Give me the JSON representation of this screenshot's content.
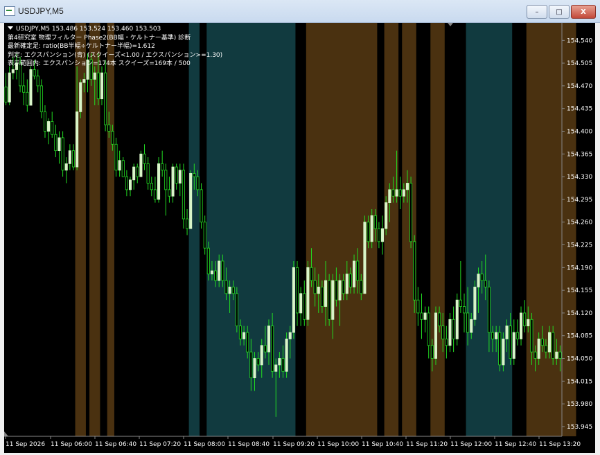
{
  "window": {
    "title": "USDJPY,M5",
    "buttons": {
      "minimize": "–",
      "maximize": "□",
      "close": "X"
    }
  },
  "info_lines": {
    "line1": "USDJPY,M5  153.486 153.524 153.460 153.503",
    "line2": "第4研究室 物理フィルター Phase2(BB幅・ケルトナー基準) 診断",
    "line3": "最新確定足: ratio(BB半幅÷ケルトナー半幅)=1.612",
    "line4": "判定: エクスパンション(青) (スクイーズ<1.00 / エクスパンション>=1.30)",
    "line5": "表示範囲内: エクスパンション=174本  スクイーズ=169本  / 500"
  },
  "colors": {
    "background": "#000000",
    "bull_body": "#d8f5c8",
    "wick": "#22dd22",
    "bear_body": "#000000",
    "squeeze_zone": "#4a3110",
    "expansion_zone": "#113a3f",
    "axis_text": "#ffffff"
  },
  "chart_data": {
    "type": "candlestick",
    "symbol": "USDJPY",
    "timeframe": "M5",
    "ylim": [
      153.93,
      154.567
    ],
    "y_ticks": [
      "154.540",
      "154.505",
      "154.470",
      "154.435",
      "154.400",
      "154.365",
      "154.330",
      "154.295",
      "154.260",
      "154.225",
      "154.190",
      "154.155",
      "154.120",
      "154.085",
      "154.050",
      "154.015",
      "153.980",
      "153.945"
    ],
    "x_ticks": [
      "11 Sep 2026",
      "11 Sep 06:00",
      "11 Sep 06:40",
      "11 Sep 07:20",
      "11 Sep 08:00",
      "11 Sep 08:40",
      "11 Sep 09:20",
      "11 Sep 10:00",
      "11 Sep 10:40",
      "11 Sep 11:20",
      "11 Sep 12:00",
      "11 Sep 12:40",
      "11 Sep 13:20"
    ],
    "zones": [
      {
        "kind": "squeeze",
        "from": 20,
        "to": 22
      },
      {
        "kind": "squeeze",
        "from": 24,
        "to": 26
      },
      {
        "kind": "squeeze",
        "from": 29,
        "to": 30
      },
      {
        "kind": "expansion",
        "from": 52,
        "to": 54
      },
      {
        "kind": "expansion",
        "from": 57,
        "to": 81
      },
      {
        "kind": "squeeze",
        "from": 85,
        "to": 104
      },
      {
        "kind": "squeeze",
        "from": 107,
        "to": 110
      },
      {
        "kind": "squeeze",
        "from": 112,
        "to": 115
      },
      {
        "kind": "squeeze",
        "from": 120,
        "to": 123
      },
      {
        "kind": "expansion",
        "from": 130,
        "to": 142
      },
      {
        "kind": "squeeze",
        "from": 147,
        "to": 160
      }
    ],
    "candles": [
      [
        154.468,
        154.49,
        154.44,
        154.445
      ],
      [
        154.445,
        154.5,
        154.44,
        154.49
      ],
      [
        154.49,
        154.515,
        154.48,
        154.495
      ],
      [
        154.495,
        154.52,
        154.48,
        154.505
      ],
      [
        154.505,
        154.515,
        154.46,
        154.47
      ],
      [
        154.47,
        154.49,
        154.44,
        154.46
      ],
      [
        154.46,
        154.48,
        154.43,
        154.44
      ],
      [
        154.44,
        154.5,
        154.44,
        154.495
      ],
      [
        154.495,
        154.51,
        154.48,
        154.485
      ],
      [
        154.485,
        154.495,
        154.46,
        154.47
      ],
      [
        154.47,
        154.48,
        154.42,
        154.43
      ],
      [
        154.43,
        154.44,
        154.39,
        154.4
      ],
      [
        154.4,
        154.42,
        154.38,
        154.415
      ],
      [
        154.415,
        154.43,
        154.39,
        154.395
      ],
      [
        154.395,
        154.41,
        154.36,
        154.37
      ],
      [
        154.37,
        154.4,
        154.35,
        154.39
      ],
      [
        154.39,
        154.4,
        154.33,
        154.34
      ],
      [
        154.34,
        154.36,
        154.32,
        154.35
      ],
      [
        154.35,
        154.38,
        154.34,
        154.37
      ],
      [
        154.37,
        154.38,
        154.34,
        154.345
      ],
      [
        154.345,
        154.5,
        154.34,
        154.43
      ],
      [
        154.43,
        154.48,
        154.42,
        154.475
      ],
      [
        154.475,
        154.49,
        154.46,
        154.48
      ],
      [
        154.48,
        154.52,
        154.46,
        154.51
      ],
      [
        154.51,
        154.52,
        154.47,
        154.48
      ],
      [
        154.48,
        154.5,
        154.44,
        154.49
      ],
      [
        154.49,
        154.52,
        154.44,
        154.45
      ],
      [
        154.45,
        154.5,
        154.44,
        154.49
      ],
      [
        154.49,
        154.51,
        154.4,
        154.41
      ],
      [
        154.41,
        154.43,
        154.39,
        154.4
      ],
      [
        154.4,
        154.41,
        154.37,
        154.38
      ],
      [
        154.38,
        154.39,
        154.33,
        154.34
      ],
      [
        154.34,
        154.37,
        154.33,
        154.355
      ],
      [
        154.355,
        154.36,
        154.33,
        154.33
      ],
      [
        154.33,
        154.34,
        154.3,
        154.31
      ],
      [
        154.31,
        154.33,
        154.3,
        154.325
      ],
      [
        154.325,
        154.35,
        154.31,
        154.345
      ],
      [
        154.345,
        154.35,
        154.32,
        154.33
      ],
      [
        154.33,
        154.37,
        154.33,
        154.365
      ],
      [
        154.365,
        154.38,
        154.34,
        154.35
      ],
      [
        154.35,
        154.36,
        154.31,
        154.32
      ],
      [
        154.32,
        154.33,
        154.3,
        154.31
      ],
      [
        154.31,
        154.33,
        154.29,
        154.295
      ],
      [
        154.295,
        154.36,
        154.29,
        154.35
      ],
      [
        154.35,
        154.37,
        154.33,
        154.34
      ],
      [
        154.34,
        154.35,
        154.27,
        154.31
      ],
      [
        154.31,
        154.33,
        154.29,
        154.3
      ],
      [
        154.3,
        154.35,
        154.29,
        154.345
      ],
      [
        154.345,
        154.35,
        154.31,
        154.32
      ],
      [
        154.32,
        154.35,
        154.3,
        154.34
      ],
      [
        154.34,
        154.35,
        154.25,
        154.265
      ],
      [
        154.265,
        154.28,
        154.24,
        154.25
      ],
      [
        154.25,
        154.34,
        154.25,
        154.335
      ],
      [
        154.335,
        154.35,
        154.31,
        154.33
      ],
      [
        154.33,
        154.34,
        154.3,
        154.31
      ],
      [
        154.31,
        154.32,
        154.25,
        154.26
      ],
      [
        154.26,
        154.27,
        154.21,
        154.22
      ],
      [
        154.22,
        154.23,
        154.17,
        154.18
      ],
      [
        154.18,
        154.2,
        154.17,
        154.185
      ],
      [
        154.185,
        154.2,
        154.16,
        154.17
      ],
      [
        154.17,
        154.21,
        154.16,
        154.2
      ],
      [
        154.2,
        154.21,
        154.16,
        154.17
      ],
      [
        154.17,
        154.19,
        154.14,
        154.15
      ],
      [
        154.15,
        154.17,
        154.12,
        154.16
      ],
      [
        154.16,
        154.17,
        154.14,
        154.15
      ],
      [
        154.15,
        154.16,
        154.09,
        154.1
      ],
      [
        154.1,
        154.11,
        154.07,
        154.08
      ],
      [
        154.08,
        154.1,
        154.07,
        154.09
      ],
      [
        154.09,
        154.1,
        154.05,
        154.06
      ],
      [
        154.06,
        154.08,
        154.0,
        154.02
      ],
      [
        154.02,
        154.06,
        154.0,
        154.05
      ],
      [
        154.05,
        154.06,
        154.03,
        154.04
      ],
      [
        154.04,
        154.08,
        154.02,
        154.07
      ],
      [
        154.07,
        154.1,
        154.05,
        154.06
      ],
      [
        154.06,
        154.11,
        154.04,
        154.1
      ],
      [
        154.1,
        154.12,
        154.02,
        154.03
      ],
      [
        154.03,
        154.05,
        153.96,
        154.04
      ],
      [
        154.04,
        154.06,
        154.02,
        154.05
      ],
      [
        154.05,
        154.07,
        154.02,
        154.03
      ],
      [
        154.03,
        154.09,
        154.02,
        154.08
      ],
      [
        154.08,
        154.1,
        154.05,
        154.09
      ],
      [
        154.09,
        154.2,
        154.08,
        154.19
      ],
      [
        154.19,
        154.2,
        154.1,
        154.12
      ],
      [
        154.12,
        154.16,
        154.1,
        154.15
      ],
      [
        154.15,
        154.17,
        154.1,
        154.11
      ],
      [
        154.11,
        154.2,
        154.1,
        154.19
      ],
      [
        154.19,
        154.22,
        154.16,
        154.17
      ],
      [
        154.17,
        154.19,
        154.13,
        154.15
      ],
      [
        154.15,
        154.18,
        154.12,
        154.16
      ],
      [
        154.16,
        154.17,
        154.12,
        154.13
      ],
      [
        154.13,
        154.2,
        154.1,
        154.17
      ],
      [
        154.17,
        154.18,
        154.1,
        154.11
      ],
      [
        154.11,
        154.18,
        154.08,
        154.17
      ],
      [
        154.17,
        154.19,
        154.13,
        154.14
      ],
      [
        154.14,
        154.18,
        154.1,
        154.17
      ],
      [
        154.17,
        154.18,
        154.14,
        154.15
      ],
      [
        154.15,
        154.2,
        154.14,
        154.18
      ],
      [
        154.18,
        154.19,
        154.15,
        154.16
      ],
      [
        154.16,
        154.21,
        154.15,
        154.2
      ],
      [
        154.2,
        154.22,
        154.15,
        154.17
      ],
      [
        154.17,
        154.18,
        154.14,
        154.15
      ],
      [
        154.15,
        154.27,
        154.15,
        154.26
      ],
      [
        154.26,
        154.27,
        154.22,
        154.23
      ],
      [
        154.23,
        154.28,
        154.22,
        154.27
      ],
      [
        154.27,
        154.28,
        154.23,
        154.25
      ],
      [
        154.25,
        154.26,
        154.22,
        154.23
      ],
      [
        154.23,
        154.27,
        154.21,
        154.25
      ],
      [
        154.25,
        154.3,
        154.24,
        154.29
      ],
      [
        154.29,
        154.32,
        154.26,
        154.31
      ],
      [
        154.31,
        154.33,
        154.29,
        154.3
      ],
      [
        154.3,
        154.37,
        154.29,
        154.31
      ],
      [
        154.31,
        154.33,
        154.28,
        154.3
      ],
      [
        154.3,
        154.32,
        154.29,
        154.31
      ],
      [
        154.31,
        154.34,
        154.29,
        154.32
      ],
      [
        154.32,
        154.33,
        154.22,
        154.23
      ],
      [
        154.23,
        154.24,
        154.12,
        154.14
      ],
      [
        154.14,
        154.16,
        154.1,
        154.12
      ],
      [
        154.12,
        154.15,
        154.08,
        154.11
      ],
      [
        154.11,
        154.13,
        154.09,
        154.12
      ],
      [
        154.12,
        154.13,
        154.05,
        154.07
      ],
      [
        154.07,
        154.08,
        154.03,
        154.05
      ],
      [
        154.05,
        154.13,
        154.04,
        154.12
      ],
      [
        154.12,
        154.13,
        154.09,
        154.1
      ],
      [
        154.1,
        154.12,
        154.06,
        154.08
      ],
      [
        154.08,
        154.1,
        154.05,
        154.07
      ],
      [
        154.07,
        154.12,
        154.06,
        154.11
      ],
      [
        154.11,
        154.13,
        154.06,
        154.08
      ],
      [
        154.08,
        154.15,
        154.07,
        154.14
      ],
      [
        154.14,
        154.2,
        154.12,
        154.13
      ],
      [
        154.13,
        154.15,
        154.09,
        154.12
      ],
      [
        154.12,
        154.16,
        154.07,
        154.09
      ],
      [
        154.09,
        154.12,
        154.08,
        154.11
      ],
      [
        154.11,
        154.17,
        154.1,
        154.16
      ],
      [
        154.16,
        154.19,
        154.12,
        154.18
      ],
      [
        154.18,
        154.2,
        154.15,
        154.17
      ],
      [
        154.17,
        154.21,
        154.14,
        154.16
      ],
      [
        154.16,
        154.17,
        154.06,
        154.09
      ],
      [
        154.09,
        154.1,
        154.06,
        154.08
      ],
      [
        154.08,
        154.1,
        154.06,
        154.09
      ],
      [
        154.09,
        154.1,
        154.03,
        154.04
      ],
      [
        154.04,
        154.09,
        154.03,
        154.08
      ],
      [
        154.08,
        154.11,
        154.06,
        154.1
      ],
      [
        154.1,
        154.12,
        154.04,
        154.05
      ],
      [
        154.05,
        154.11,
        154.04,
        154.09
      ],
      [
        154.09,
        154.11,
        154.07,
        154.08
      ],
      [
        154.08,
        154.13,
        154.07,
        154.12
      ],
      [
        154.12,
        154.14,
        154.09,
        154.1
      ],
      [
        154.1,
        154.13,
        154.09,
        154.11
      ],
      [
        154.11,
        154.12,
        154.04,
        154.06
      ],
      [
        154.06,
        154.07,
        154.03,
        154.05
      ],
      [
        154.05,
        154.09,
        154.04,
        154.08
      ],
      [
        154.08,
        154.1,
        154.06,
        154.07
      ],
      [
        154.07,
        154.08,
        154.05,
        154.06
      ],
      [
        154.06,
        154.1,
        154.05,
        154.09
      ],
      [
        154.09,
        154.1,
        154.04,
        154.05
      ],
      [
        154.05,
        154.08,
        154.04,
        154.06
      ],
      [
        154.06,
        154.07,
        154.03,
        154.05
      ]
    ]
  }
}
